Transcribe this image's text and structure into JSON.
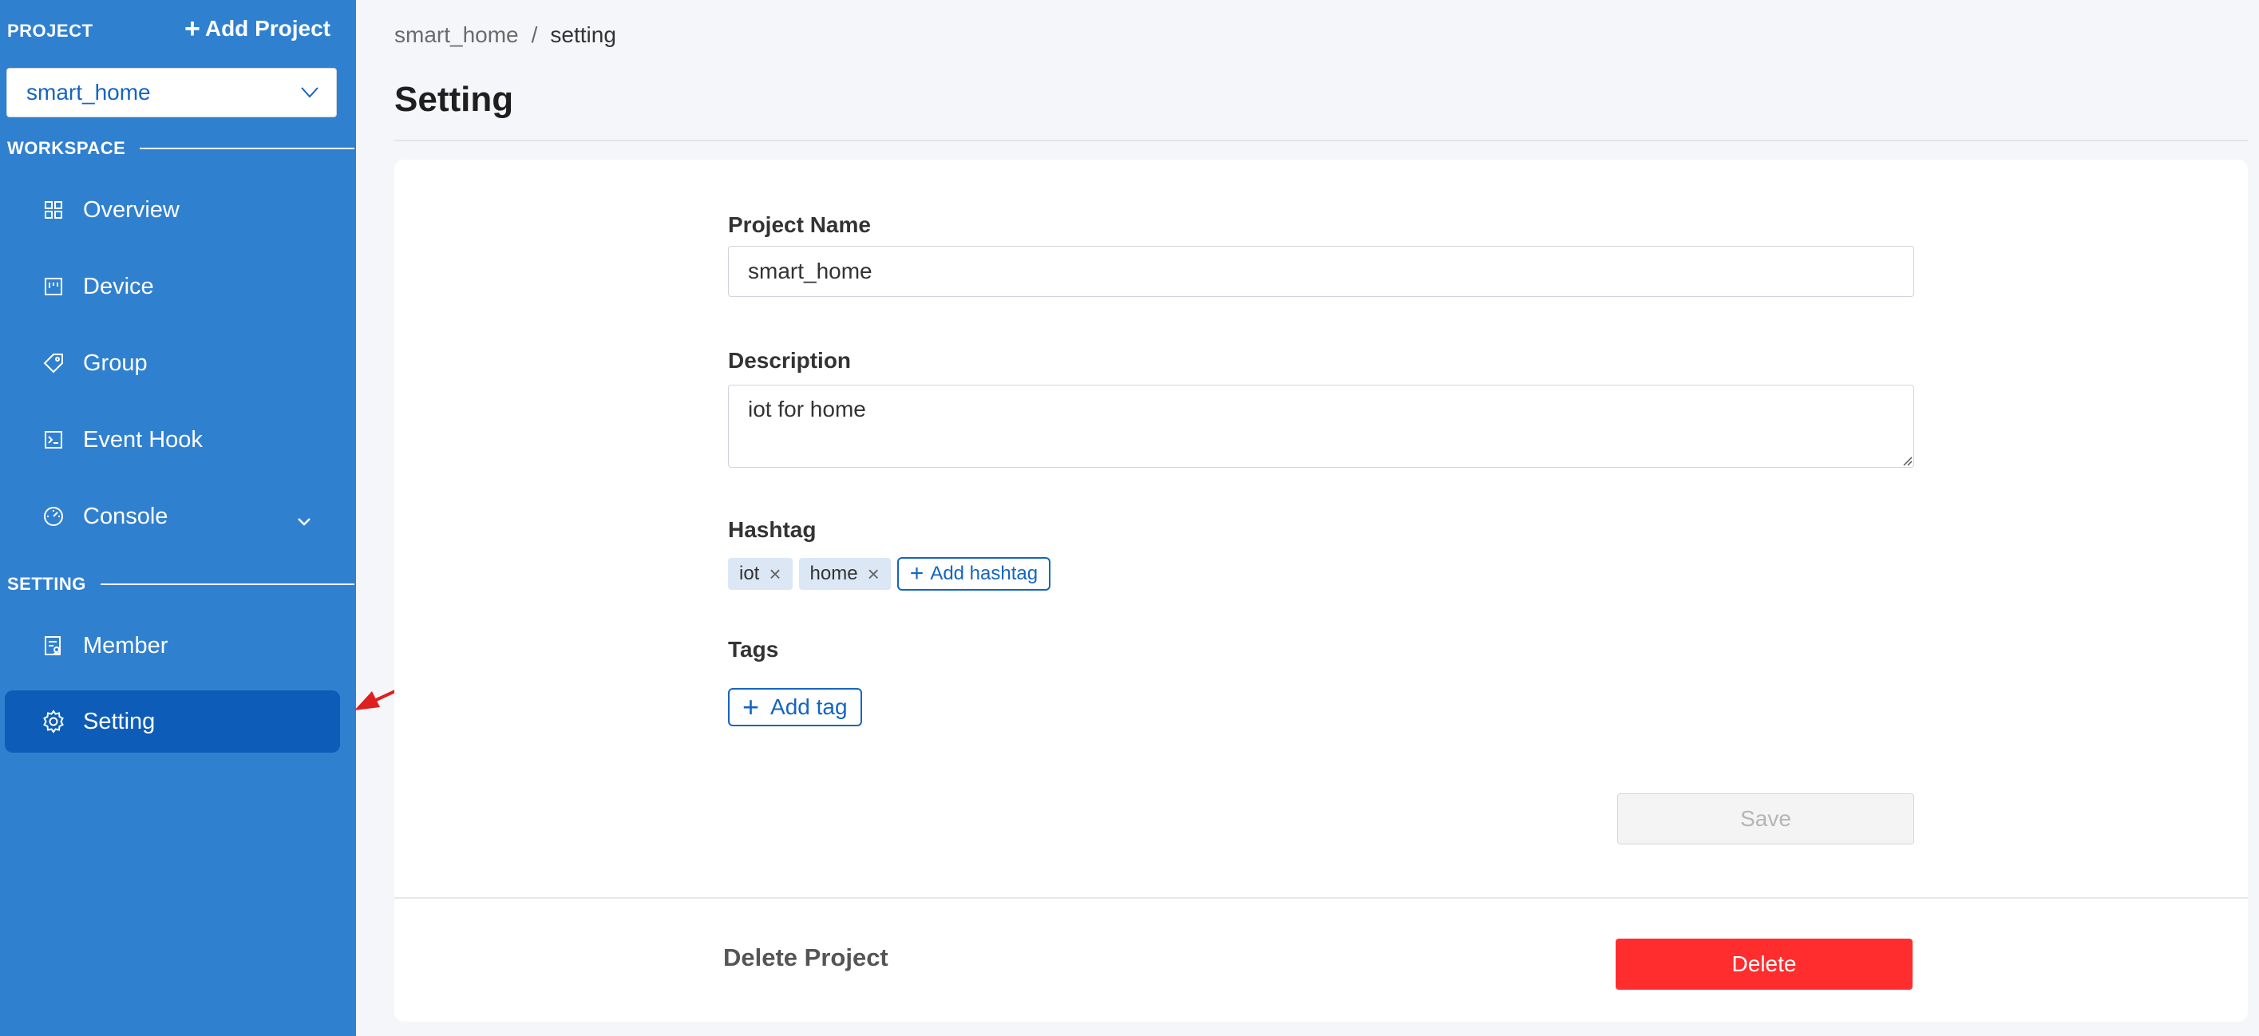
{
  "sidebar": {
    "project_label": "PROJECT",
    "add_project_label": "Add Project",
    "project_select_value": "smart_home",
    "workspace_label": "WORKSPACE",
    "setting_label": "SETTING",
    "items": [
      {
        "label": "Overview",
        "icon": "grid-icon"
      },
      {
        "label": "Device",
        "icon": "device-icon"
      },
      {
        "label": "Group",
        "icon": "tag-icon"
      },
      {
        "label": "Event Hook",
        "icon": "terminal-icon"
      },
      {
        "label": "Console",
        "icon": "dashboard-icon"
      },
      {
        "label": "Member",
        "icon": "member-icon"
      },
      {
        "label": "Setting",
        "icon": "gear-icon",
        "active": true
      }
    ]
  },
  "breadcrumb": {
    "project": "smart_home",
    "separator": "/",
    "current": "setting"
  },
  "page": {
    "title": "Setting"
  },
  "form": {
    "project_name_label": "Project Name",
    "project_name_value": "smart_home",
    "description_label": "Description",
    "description_value": "iot for home",
    "hashtag_label": "Hashtag",
    "hashtags": [
      "iot",
      "home"
    ],
    "add_hashtag_label": "Add hashtag",
    "tags_label": "Tags",
    "add_tag_label": "Add tag",
    "save_label": "Save"
  },
  "danger": {
    "delete_project_label": "Delete Project",
    "delete_button_label": "Delete"
  },
  "colors": {
    "sidebar_bg": "#3080d0",
    "sidebar_active": "#0d5cb8",
    "accent": "#1565c0",
    "danger": "#ff2d2d"
  }
}
